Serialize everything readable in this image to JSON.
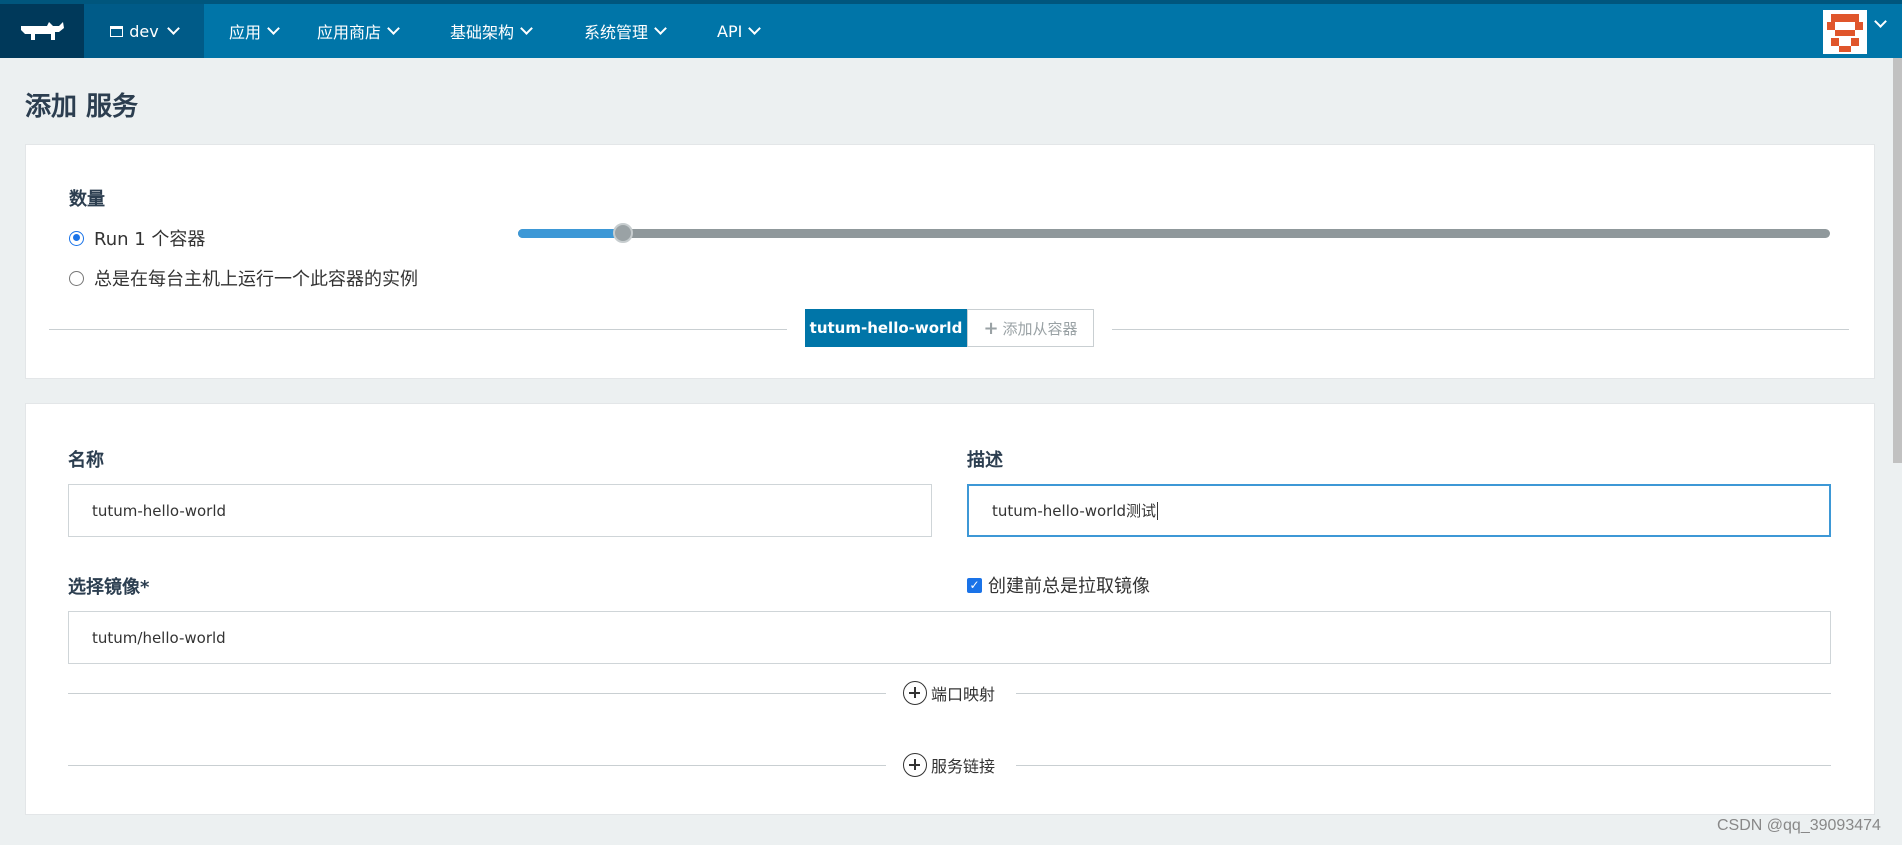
{
  "nav": {
    "environment": "dev",
    "items": [
      {
        "label": "应用"
      },
      {
        "label": "应用商店"
      },
      {
        "label": "基础架构"
      },
      {
        "label": "系统管理"
      },
      {
        "label": "API"
      }
    ]
  },
  "page": {
    "title": "添加 服务"
  },
  "scale": {
    "label": "数量",
    "option_run": "Run 1 个容器",
    "option_always": "总是在每台主机上运行一个此容器的实例",
    "slider_value": 1,
    "slider_fraction": 0.08
  },
  "containers": {
    "active_tab": "tutum-hello-world",
    "add_tab": "添加从容器"
  },
  "form": {
    "name_label": "名称",
    "name_value": "tutum-hello-world",
    "desc_label": "描述",
    "desc_value": "tutum-hello-world测试",
    "image_label": "选择镜像*",
    "image_value": "tutum/hello-world",
    "pull_label": "创建前总是拉取镜像",
    "pull_checked": true,
    "port_mapping": "端口映射",
    "service_links": "服务链接"
  },
  "watermark": "CSDN @qq_39093474",
  "colors": {
    "nav_bg": "#0075a8",
    "accent": "#3d98d6",
    "page_bg": "#ecf0f1"
  }
}
